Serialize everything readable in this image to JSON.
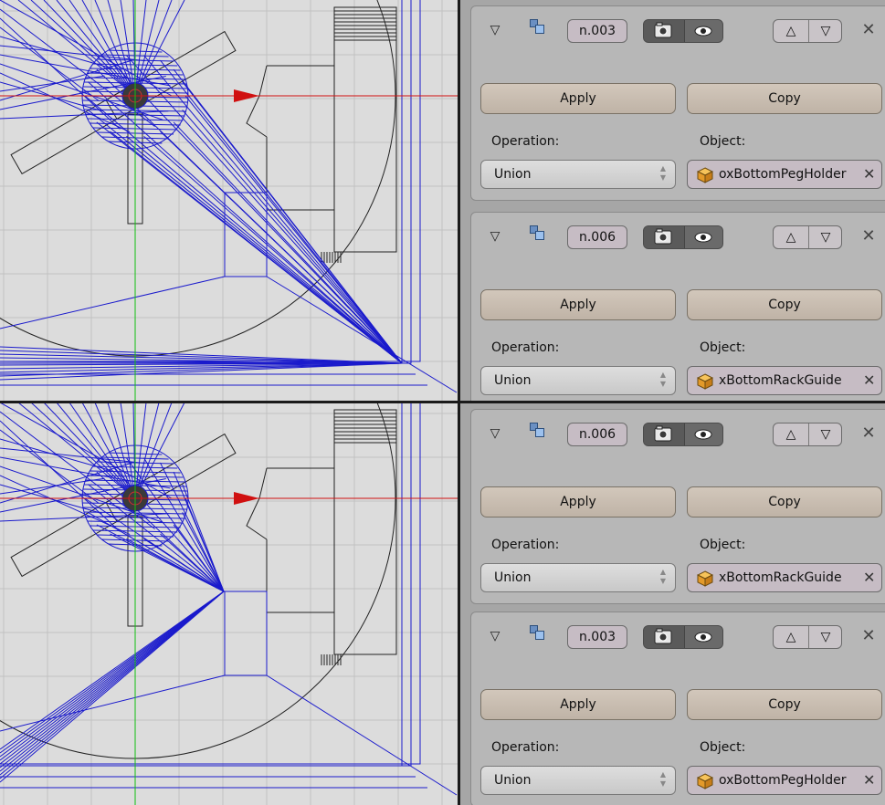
{
  "modifier_panels": [
    {
      "id": "top-1",
      "name": "n.003",
      "apply_label": "Apply",
      "copy_label": "Copy",
      "operation_label": "Operation:",
      "object_label": "Object:",
      "operation_value": "Union",
      "object_value": "oxBottomPegHolder"
    },
    {
      "id": "top-2",
      "name": "n.006",
      "apply_label": "Apply",
      "copy_label": "Copy",
      "operation_label": "Operation:",
      "object_label": "Object:",
      "operation_value": "Union",
      "object_value": "xBottomRackGuide"
    },
    {
      "id": "bottom-1",
      "name": "n.006",
      "apply_label": "Apply",
      "copy_label": "Copy",
      "operation_label": "Operation:",
      "object_label": "Object:",
      "operation_value": "Union",
      "object_value": "xBottomRackGuide"
    },
    {
      "id": "bottom-2",
      "name": "n.003",
      "apply_label": "Apply",
      "copy_label": "Copy",
      "operation_label": "Operation:",
      "object_label": "Object:",
      "operation_value": "Union",
      "object_value": "oxBottomPegHolder"
    }
  ],
  "icons": {
    "expand": "triangle-down-icon",
    "modifier_type": "boolean-modifier-icon",
    "render": "camera-icon",
    "viewport_display": "eye-icon",
    "move_up": "triangle-up-icon",
    "move_down": "triangle-down-icon",
    "remove": "close-x-icon",
    "object": "mesh-cube-icon"
  },
  "colors": {
    "viewport_bg": "#dcdcdc",
    "wire_blue": "#1a1acc",
    "x_axis": "#d01010",
    "y_axis": "#10c010",
    "button": "#c9bdb0",
    "name_field": "#c6bcc4",
    "panel_bg": "#b7b7b7"
  }
}
